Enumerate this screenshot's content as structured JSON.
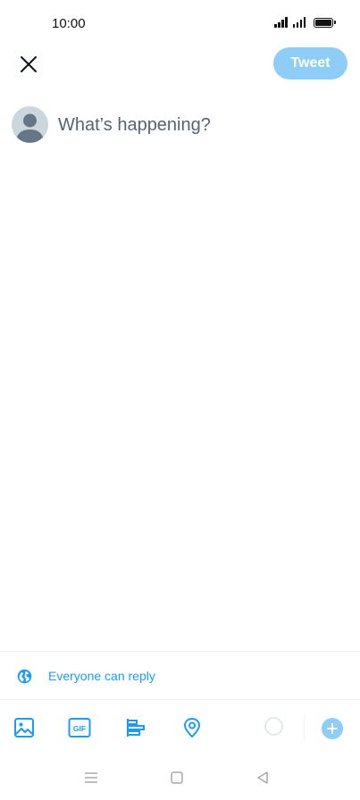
{
  "status_bar": {
    "time": "10:00"
  },
  "header": {
    "close_icon": "close-icon",
    "tweet_button_label": "Tweet"
  },
  "compose": {
    "placeholder": "What’s happening?",
    "value": ""
  },
  "reply_settings": {
    "icon": "globe-icon",
    "label": "Everyone can reply"
  },
  "toolbar": {
    "items": [
      "image-icon",
      "gif-icon",
      "poll-icon",
      "location-icon"
    ],
    "gif_label": "GIF"
  },
  "nav_bar": {
    "items": [
      "menu-icon",
      "home-square-icon",
      "back-triangle-icon"
    ]
  },
  "colors": {
    "accent": "#1d9bf0",
    "tweet_button_disabled": "#8ecdf8",
    "placeholder": "#536471"
  }
}
